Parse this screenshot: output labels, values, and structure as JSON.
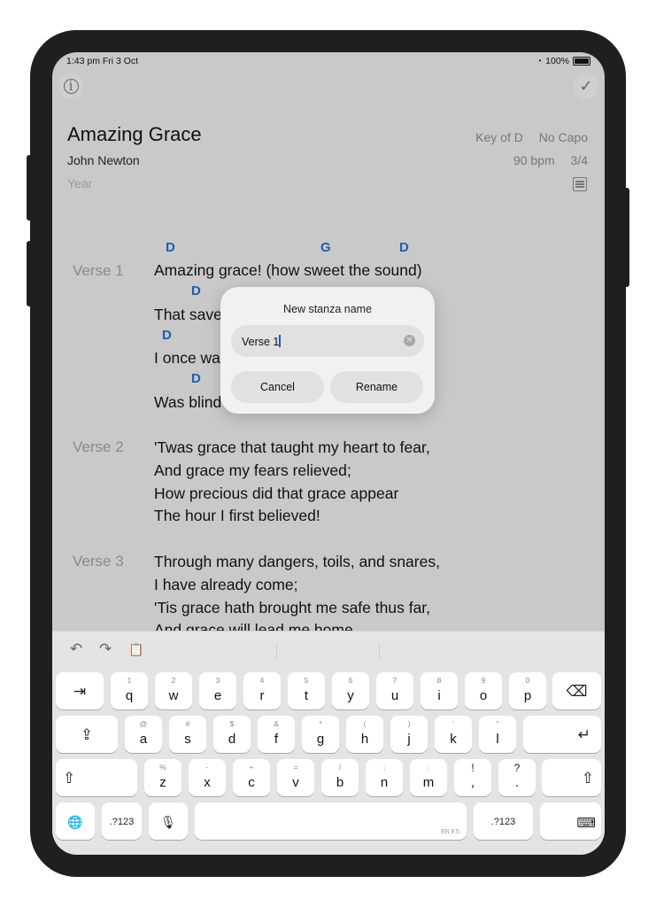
{
  "status": {
    "time_date": "1:43 pm   Fri 3 Oct",
    "battery": "100%"
  },
  "icons": {
    "info": "info-icon",
    "done": "checkmark-icon",
    "wifi": "wifi-icon",
    "battery": "battery-icon",
    "notes": "notes-icon"
  },
  "song": {
    "title": "Amazing Grace",
    "author": "John Newton",
    "year_placeholder": "Year",
    "key": "Key of D",
    "capo": "No Capo",
    "bpm": "90 bpm",
    "time_signature": "3/4"
  },
  "stanzas": [
    {
      "label": "Verse 1",
      "lines": [
        "Amazing grace! (how sweet the sound)",
        "That save",
        "I once wa",
        "Was blind"
      ],
      "chords": [
        [
          "D",
          "G",
          "D"
        ],
        [
          "D"
        ],
        [
          "D"
        ],
        [
          "D"
        ]
      ]
    },
    {
      "label": "Verse 2",
      "lines": [
        "'Twas grace that taught my heart to fear,",
        "And grace my fears relieved;",
        "How precious did that grace appear",
        "The hour I first believed!"
      ]
    },
    {
      "label": "Verse 3",
      "lines": [
        "Through many dangers, toils, and snares,",
        "I have already come;",
        "'Tis grace hath brought me safe thus far,",
        "And grace will lead me home."
      ]
    }
  ],
  "dialog": {
    "title": "New stanza name",
    "input_value": "Verse 1",
    "cancel": "Cancel",
    "confirm": "Rename"
  },
  "keyboard": {
    "toolbar": [
      "↶",
      "↷",
      "📋"
    ],
    "row1": [
      {
        "k": "q",
        "h": "1"
      },
      {
        "k": "w",
        "h": "2"
      },
      {
        "k": "e",
        "h": "3"
      },
      {
        "k": "r",
        "h": "4"
      },
      {
        "k": "t",
        "h": "5"
      },
      {
        "k": "y",
        "h": "6"
      },
      {
        "k": "u",
        "h": "7"
      },
      {
        "k": "i",
        "h": "8"
      },
      {
        "k": "o",
        "h": "9"
      },
      {
        "k": "p",
        "h": "0"
      }
    ],
    "row2": [
      {
        "k": "a",
        "h": "@"
      },
      {
        "k": "s",
        "h": "#"
      },
      {
        "k": "d",
        "h": "$"
      },
      {
        "k": "f",
        "h": "&"
      },
      {
        "k": "g",
        "h": "*"
      },
      {
        "k": "h",
        "h": "("
      },
      {
        "k": "j",
        "h": ")"
      },
      {
        "k": "k",
        "h": "'"
      },
      {
        "k": "l",
        "h": "\""
      }
    ],
    "row3": [
      {
        "k": "z",
        "h": "%"
      },
      {
        "k": "x",
        "h": "-"
      },
      {
        "k": "c",
        "h": "+"
      },
      {
        "k": "v",
        "h": "="
      },
      {
        "k": "b",
        "h": "/"
      },
      {
        "k": "n",
        "h": ";"
      },
      {
        "k": "m",
        "h": ":"
      },
      {
        "k": ",",
        "h": "!"
      },
      {
        "k": ".",
        "h": "?"
      }
    ],
    "tab": "⇥",
    "backspace": "⌫",
    "caps": "⇪",
    "return": "↵",
    "shift": "⇧",
    "globe": "🌐",
    "numbers": ".?123",
    "mic": "🎙",
    "dismiss": "⌨",
    "space_lang": "EN ES"
  }
}
